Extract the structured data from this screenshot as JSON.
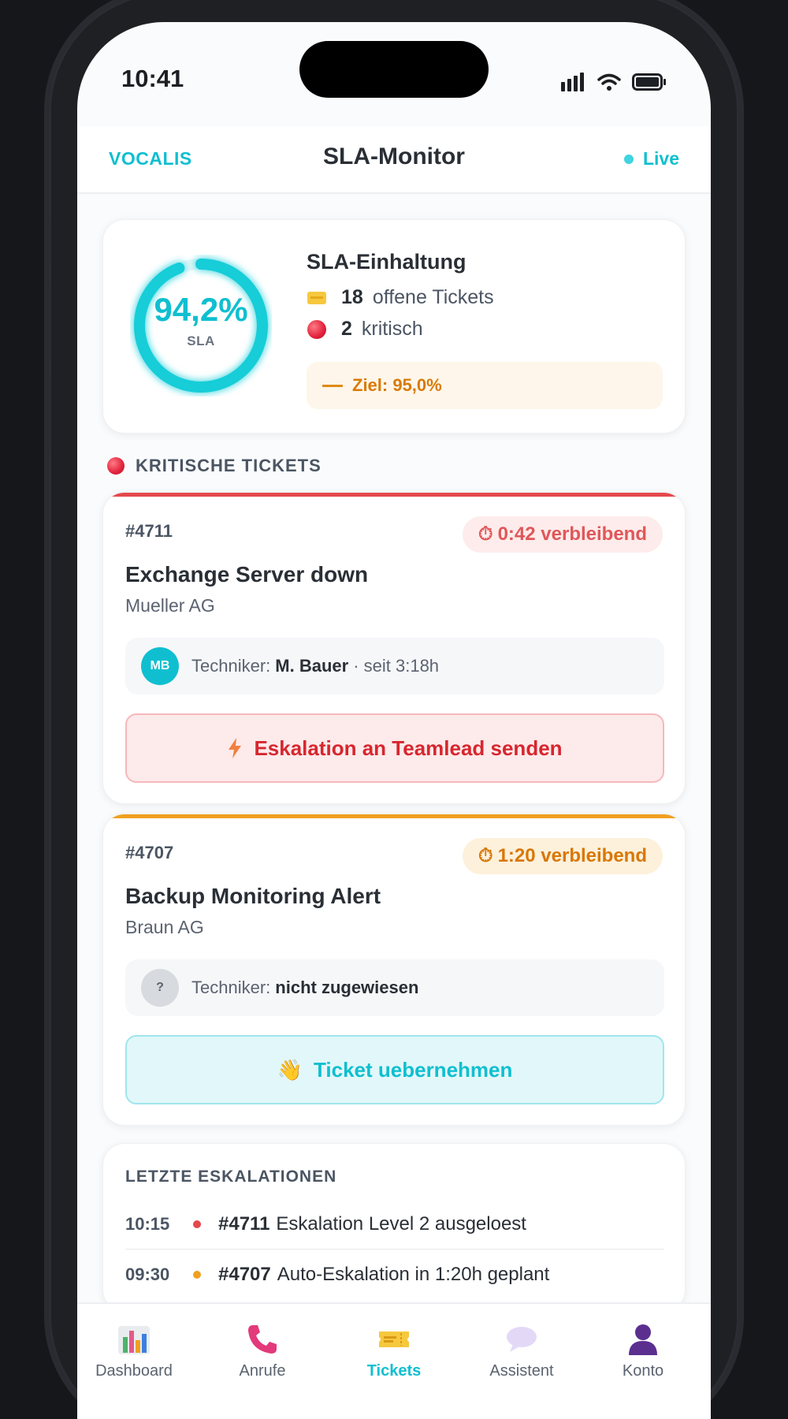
{
  "status_bar": {
    "time": "10:41"
  },
  "header": {
    "brand": "VOCALIS",
    "title": "SLA-Monitor",
    "live_label": "Live"
  },
  "sla": {
    "compliance_value": "94,2%",
    "compliance_fraction": 0.942,
    "ring_label": "SLA",
    "title": "SLA-Einhaltung",
    "open_count": "18",
    "open_label": "offene Tickets",
    "open_icon": "ticket-icon",
    "critical_count": "2",
    "critical_label": "kritisch",
    "critical_icon": "red-circle-icon",
    "goal_label": "Ziel: 95,0%"
  },
  "critical_section_label": "KRITISCHE TICKETS",
  "tickets": [
    {
      "id": "#4711",
      "remaining": "0:42 verbleibend",
      "title": "Exchange Server down",
      "company": "Mueller AG",
      "tech_prefix": "Techniker:",
      "tech_name": "M. Bauer",
      "tech_suffix": "· seit 3:18h",
      "avatar_initials": "MB",
      "action_label": "Eskalation an Teamlead senden",
      "action_icon": "lightning-icon",
      "accent_color": "#e5484d"
    },
    {
      "id": "#4707",
      "remaining": "1:20 verbleibend",
      "title": "Backup Monitoring Alert",
      "company": "Braun AG",
      "tech_prefix": "Techniker:",
      "tech_name": "nicht zugewiesen",
      "avatar_initials": "?",
      "action_label": "Ticket uebernehmen",
      "action_icon": "waving-hand-icon",
      "accent_color": "#f0a020"
    }
  ],
  "escalations": {
    "title": "LETZTE ESKALATIONEN",
    "items": [
      {
        "time": "10:15",
        "ticket": "#4711",
        "text": "Eskalation Level 2 ausgeloest",
        "dot_color": "#e5484d"
      },
      {
        "time": "09:30",
        "ticket": "#4707",
        "text": "Auto-Eskalation in 1:20h geplant",
        "dot_color": "#f0a020"
      }
    ]
  },
  "tabbar": {
    "items": [
      {
        "label": "Dashboard",
        "icon": "bar-chart-icon"
      },
      {
        "label": "Anrufe",
        "icon": "phone-icon"
      },
      {
        "label": "Tickets",
        "icon": "ticket-icon",
        "active": true
      },
      {
        "label": "Assistent",
        "icon": "speech-bubble-icon"
      },
      {
        "label": "Konto",
        "icon": "user-icon"
      }
    ]
  },
  "colors": {
    "accent": "#0fbfd0",
    "critical": "#e5484d",
    "warning": "#f0a020"
  }
}
